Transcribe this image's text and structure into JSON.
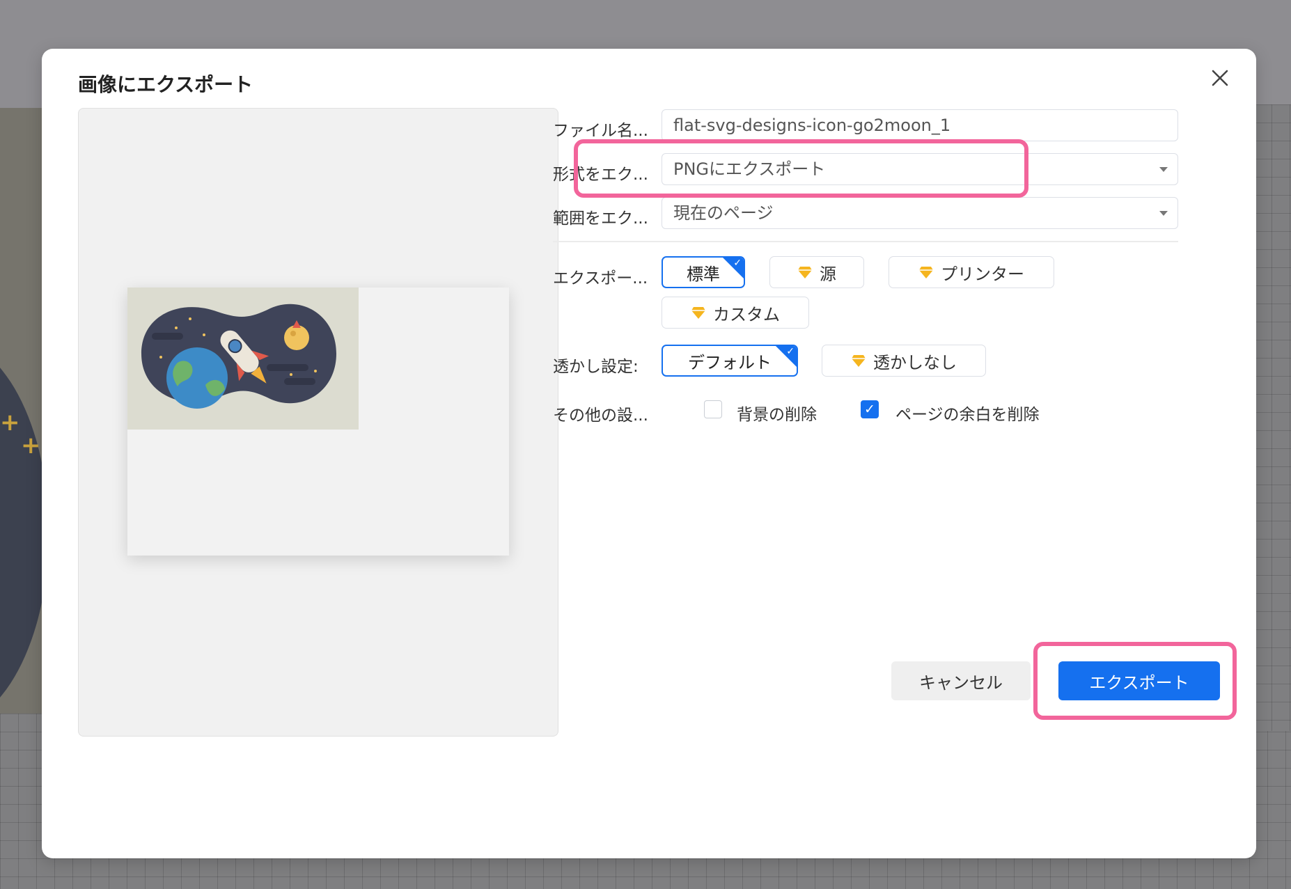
{
  "dialog": {
    "title": "画像にエクスポート",
    "close_icon": "close-icon"
  },
  "form": {
    "filename": {
      "label": "ファイル名...",
      "value": "flat-svg-designs-icon-go2moon_1"
    },
    "format": {
      "label": "形式をエク...",
      "value": "PNGにエクスポート"
    },
    "range": {
      "label": "範囲をエク...",
      "value": "現在のページ"
    },
    "quality": {
      "label": "エクスポー...",
      "options": [
        "標準",
        "源",
        "プリンター",
        "カスタム"
      ],
      "selected": "標準"
    },
    "watermark": {
      "label": "透かし設定:",
      "options": [
        "デフォルト",
        "透かしなし"
      ],
      "selected": "デフォルト"
    },
    "other": {
      "label": "その他の設...",
      "remove_background": {
        "label": "背景の削除",
        "checked": false
      },
      "remove_margin": {
        "label": "ページの余白を削除",
        "checked": true
      }
    }
  },
  "buttons": {
    "cancel": "キャンセル",
    "export": "エクスポート"
  },
  "colors": {
    "accent": "#1570ef",
    "highlight": "#f2659b",
    "premium_gem": "#f5b51f"
  }
}
